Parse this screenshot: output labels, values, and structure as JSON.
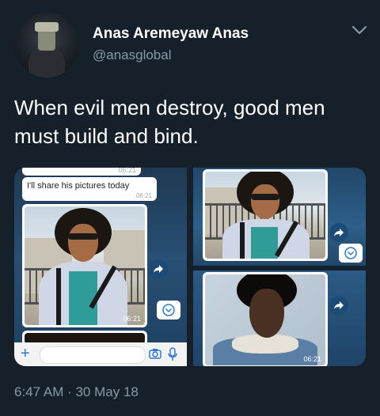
{
  "author": {
    "name": "Anas Aremeyaw Anas",
    "handle": "@anasglobal"
  },
  "tweet": {
    "text": "When evil men destroy, good men must build and bind.",
    "timestamp": "6:47 AM · 30 May 18"
  },
  "media": {
    "chat_message": "I'll share his pictures today",
    "times": {
      "top_bubble": "06:21",
      "message": "06:21",
      "photo1": "06:21",
      "photo3": "06:21"
    }
  },
  "colors": {
    "background": "#15202b",
    "secondary_text": "#8899a6",
    "whatsapp_blue": "#2a7bd1"
  }
}
